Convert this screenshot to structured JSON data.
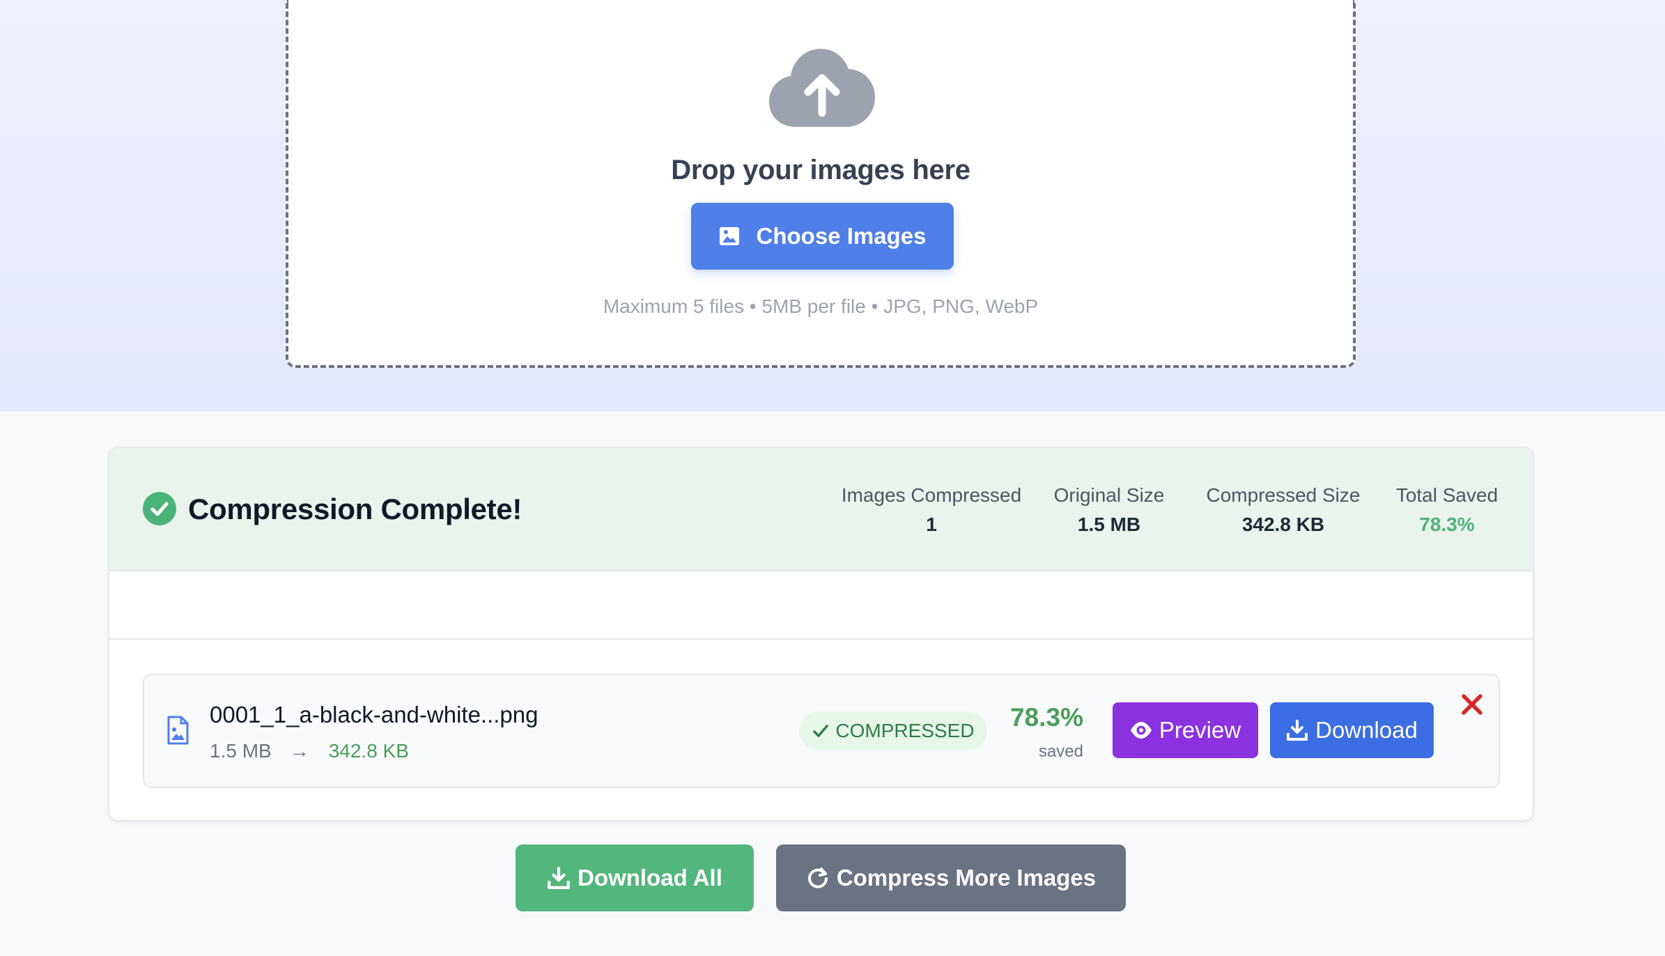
{
  "upload": {
    "title": "Drop your images here",
    "choose_button": "Choose Images",
    "hint": "Maximum 5 files • 5MB per file • JPG, PNG, WebP"
  },
  "summary": {
    "title": "Compression Complete!",
    "stats": [
      {
        "label": "Images Compressed",
        "value": "1"
      },
      {
        "label": "Original Size",
        "value": "1.5 MB"
      },
      {
        "label": "Compressed Size",
        "value": "342.8 KB"
      },
      {
        "label": "Total Saved",
        "value": "78.3%"
      }
    ]
  },
  "files": [
    {
      "name": "0001_1_a-black-and-white...png",
      "original_size": "1.5 MB",
      "compressed_size": "342.8 KB",
      "status": "COMPRESSED",
      "saved_percent": "78.3%",
      "saved_label": "saved",
      "preview_label": "Preview",
      "download_label": "Download"
    }
  ],
  "actions": {
    "download_all": "Download All",
    "compress_more": "Compress More Images"
  },
  "colors": {
    "primary": "#4f7fe9",
    "success": "#52b67d",
    "preview": "#8b32e0",
    "download": "#3b6ee2",
    "danger": "#d62828",
    "neutral": "#6b7280"
  },
  "icons": [
    "cloud-upload-icon",
    "image-icon",
    "check-circle-icon",
    "file-image-icon",
    "arrow-right-icon",
    "check-icon",
    "eye-icon",
    "download-icon",
    "close-icon",
    "refresh-icon"
  ]
}
